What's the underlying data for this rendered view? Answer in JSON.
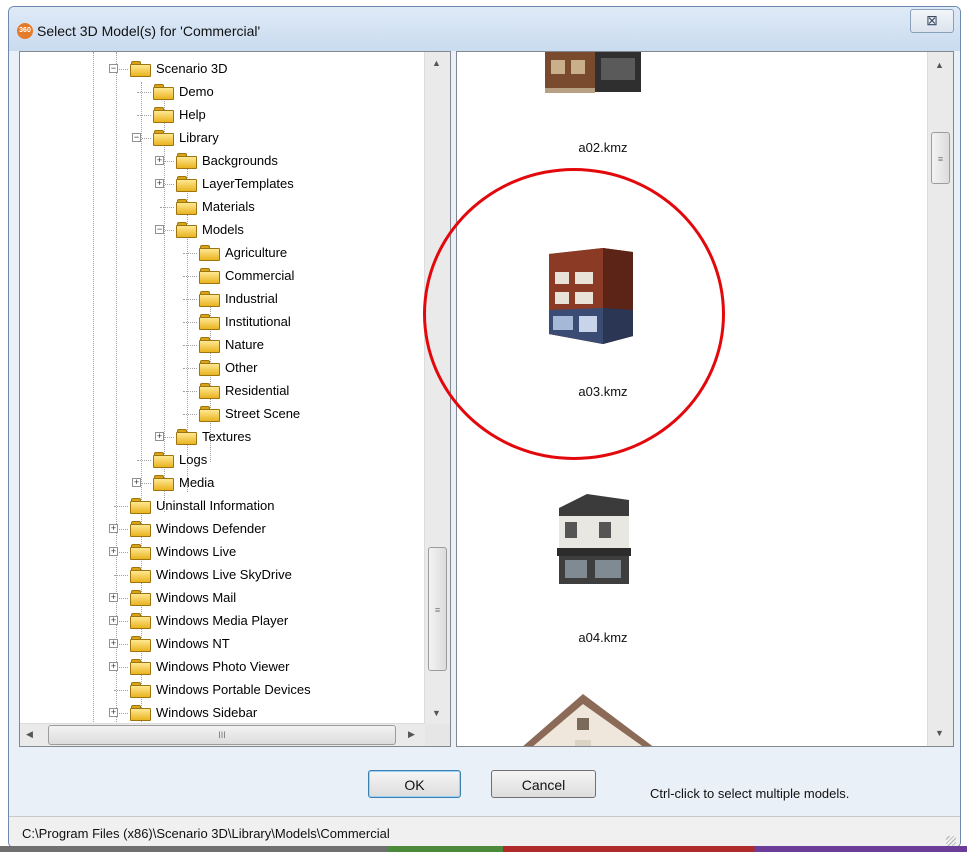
{
  "window": {
    "title": "Select 3D Model(s) for 'Commercial'",
    "app_icon_text": "360",
    "close_glyph": "⊠"
  },
  "tree": {
    "items": [
      {
        "label": "Scenario 3D",
        "expander": "minus"
      },
      {
        "label": "Demo",
        "expander": ""
      },
      {
        "label": "Help",
        "expander": ""
      },
      {
        "label": "Library",
        "expander": "minus"
      },
      {
        "label": "Backgrounds",
        "expander": "plus"
      },
      {
        "label": "LayerTemplates",
        "expander": "plus"
      },
      {
        "label": "Materials",
        "expander": ""
      },
      {
        "label": "Models",
        "expander": "minus"
      },
      {
        "label": "Agriculture",
        "expander": ""
      },
      {
        "label": "Commercial",
        "expander": ""
      },
      {
        "label": "Industrial",
        "expander": ""
      },
      {
        "label": "Institutional",
        "expander": ""
      },
      {
        "label": "Nature",
        "expander": ""
      },
      {
        "label": "Other",
        "expander": ""
      },
      {
        "label": "Residential",
        "expander": ""
      },
      {
        "label": "Street Scene",
        "expander": ""
      },
      {
        "label": "Textures",
        "expander": "plus"
      },
      {
        "label": "Logs",
        "expander": ""
      },
      {
        "label": "Media",
        "expander": "plus"
      },
      {
        "label": "Uninstall Information",
        "expander": ""
      },
      {
        "label": "Windows Defender",
        "expander": "plus"
      },
      {
        "label": "Windows Live",
        "expander": "plus"
      },
      {
        "label": "Windows Live SkyDrive",
        "expander": ""
      },
      {
        "label": "Windows Mail",
        "expander": "plus"
      },
      {
        "label": "Windows Media Player",
        "expander": "plus"
      },
      {
        "label": "Windows NT",
        "expander": "plus"
      },
      {
        "label": "Windows Photo Viewer",
        "expander": "plus"
      },
      {
        "label": "Windows Portable Devices",
        "expander": ""
      },
      {
        "label": "Windows Sidebar",
        "expander": "plus"
      }
    ],
    "scroll_glyphs": {
      "up": "▲",
      "down": "▼",
      "left": "◀",
      "right": "▶",
      "vgrip": "≡",
      "hgrip": "III"
    }
  },
  "models": {
    "items": [
      {
        "filename": "a02.kmz"
      },
      {
        "filename": "a03.kmz"
      },
      {
        "filename": "a04.kmz"
      }
    ],
    "selected": "a03.kmz",
    "highlight_color": "#e3080b"
  },
  "footer": {
    "ok_label": "OK",
    "cancel_label": "Cancel",
    "hint": "Ctrl-click to select multiple models."
  },
  "status": {
    "path": "C:\\Program Files (x86)\\Scenario 3D\\Library\\Models\\Commercial"
  }
}
